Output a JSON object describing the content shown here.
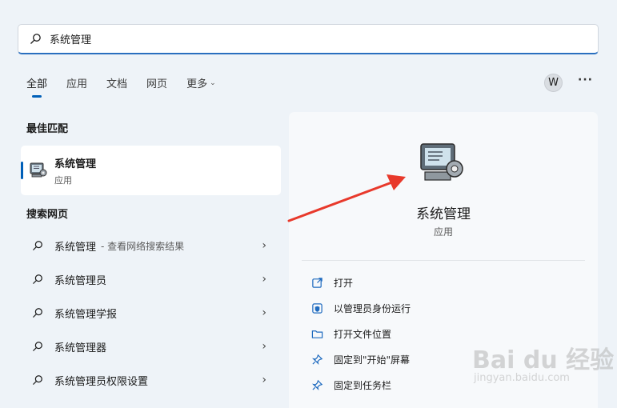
{
  "search": {
    "query": "系统管理"
  },
  "tabs": [
    {
      "label": "全部",
      "active": true
    },
    {
      "label": "应用"
    },
    {
      "label": "文档"
    },
    {
      "label": "网页"
    },
    {
      "label": "更多"
    }
  ],
  "header": {
    "avatar_letter": "W",
    "more_label": "···"
  },
  "best_match": {
    "heading": "最佳匹配",
    "name": "系统管理",
    "type": "应用"
  },
  "web_search": {
    "heading": "搜索网页",
    "items": [
      {
        "label": "系统管理",
        "sub": "- 查看网络搜索结果"
      },
      {
        "label": "系统管理员"
      },
      {
        "label": "系统管理学报"
      },
      {
        "label": "系统管理器"
      },
      {
        "label": "系统管理员权限设置"
      }
    ]
  },
  "preview": {
    "name": "系统管理",
    "type": "应用",
    "actions": [
      {
        "label": "打开",
        "icon": "open-icon"
      },
      {
        "label": "以管理员身份运行",
        "icon": "shield-icon"
      },
      {
        "label": "打开文件位置",
        "icon": "folder-icon"
      },
      {
        "label": "固定到\"开始\"屏幕",
        "icon": "pin-icon"
      },
      {
        "label": "固定到任务栏",
        "icon": "pin-icon"
      }
    ]
  },
  "watermark": {
    "main": "Bai du 经验",
    "sub": "jingyan.baidu.com"
  },
  "colors": {
    "accent": "#005fb8",
    "annotation_arrow": "#e8392b"
  }
}
